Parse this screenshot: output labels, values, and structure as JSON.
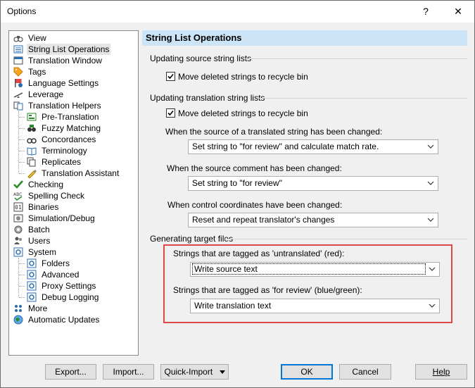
{
  "window": {
    "title": "Options",
    "help_glyph": "?",
    "close_glyph": "✕"
  },
  "tree": [
    {
      "id": "view",
      "label": "View",
      "icon": "binoculars-icon",
      "level": 0
    },
    {
      "id": "string-list-operations",
      "label": "String List Operations",
      "icon": "list-icon",
      "level": 0,
      "selected": true
    },
    {
      "id": "translation-window",
      "label": "Translation Window",
      "icon": "window-icon",
      "level": 0
    },
    {
      "id": "tags",
      "label": "Tags",
      "icon": "tag-icon",
      "level": 0
    },
    {
      "id": "language-settings",
      "label": "Language Settings",
      "icon": "flag-icon",
      "level": 0
    },
    {
      "id": "leverage",
      "label": "Leverage",
      "icon": "leverage-icon",
      "level": 0
    },
    {
      "id": "translation-helpers",
      "label": "Translation Helpers",
      "icon": "helpers-icon",
      "level": 0
    },
    {
      "id": "pre-translation",
      "label": "Pre-Translation",
      "icon": "pretranslation-icon",
      "level": 1
    },
    {
      "id": "fuzzy-matching",
      "label": "Fuzzy Matching",
      "icon": "fuzzy-icon",
      "level": 1
    },
    {
      "id": "concordances",
      "label": "Concordances",
      "icon": "concordance-icon",
      "level": 1
    },
    {
      "id": "terminology",
      "label": "Terminology",
      "icon": "book-icon",
      "level": 1
    },
    {
      "id": "replicates",
      "label": "Replicates",
      "icon": "replicates-icon",
      "level": 1
    },
    {
      "id": "translation-assistant",
      "label": "Translation Assistant",
      "icon": "pen-icon",
      "level": 1
    },
    {
      "id": "checking",
      "label": "Checking",
      "icon": "checkmark-icon",
      "level": 0
    },
    {
      "id": "spelling-check",
      "label": "Spelling Check",
      "icon": "spelling-icon",
      "level": 0
    },
    {
      "id": "binaries",
      "label": "Binaries",
      "icon": "binary-icon",
      "level": 0
    },
    {
      "id": "simulation-debug",
      "label": "Simulation/Debug",
      "icon": "debug-icon",
      "level": 0
    },
    {
      "id": "batch",
      "label": "Batch",
      "icon": "batch-icon",
      "level": 0
    },
    {
      "id": "users",
      "label": "Users",
      "icon": "users-icon",
      "level": 0
    },
    {
      "id": "system",
      "label": "System",
      "icon": "system-icon",
      "level": 0
    },
    {
      "id": "folders",
      "label": "Folders",
      "icon": "folder-settings-icon",
      "level": 1
    },
    {
      "id": "advanced",
      "label": "Advanced",
      "icon": "advanced-settings-icon",
      "level": 1
    },
    {
      "id": "proxy-settings",
      "label": "Proxy Settings",
      "icon": "proxy-settings-icon",
      "level": 1
    },
    {
      "id": "debug-logging",
      "label": "Debug Logging",
      "icon": "debug-logging-icon",
      "level": 1
    },
    {
      "id": "more",
      "label": "More",
      "icon": "more-icon",
      "level": 0
    },
    {
      "id": "automatic-updates",
      "label": "Automatic Updates",
      "icon": "globe-icon",
      "level": 0
    }
  ],
  "panel": {
    "title": "String List Operations",
    "source_group": {
      "label": "Updating source string lists",
      "move_deleted": {
        "label": "Move deleted strings to recycle bin",
        "checked": true
      }
    },
    "translation_group": {
      "label": "Updating translation string lists",
      "move_deleted": {
        "label": "Move deleted strings to recycle bin",
        "checked": true
      },
      "source_changed": {
        "label": "When the source of a translated string has been changed:",
        "value": "Set string to \"for review\" and calculate match rate."
      },
      "comment_changed": {
        "label": "When the source comment has been changed:",
        "value": "Set string to \"for review\""
      },
      "coords_changed": {
        "label": "When control coordinates have been changed:",
        "value": "Reset and repeat translator's changes"
      }
    },
    "target_group": {
      "label": "Generating target files",
      "untranslated": {
        "label": "Strings that are tagged as 'untranslated' (red):",
        "value": "Write source text"
      },
      "for_review": {
        "label": "Strings that are tagged as 'for review' (blue/green):",
        "value": "Write translation text"
      }
    }
  },
  "buttons": {
    "export": "Export...",
    "import": "Import...",
    "quick_import": "Quick-Import",
    "ok": "OK",
    "cancel": "Cancel",
    "help": "Help"
  },
  "colors": {
    "highlight": "#e04848",
    "header": "#cce4f7",
    "accent": "#0078d7"
  }
}
